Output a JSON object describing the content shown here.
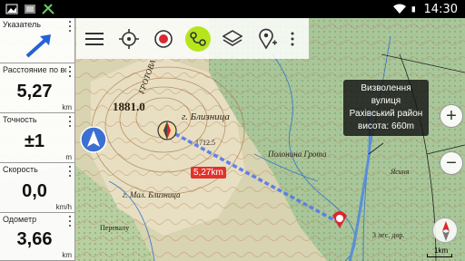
{
  "status_bar": {
    "time": "14:30",
    "left_icons": [
      "photo-icon",
      "image-icon",
      "tools-icon"
    ],
    "right_icons": [
      "wifi-icon",
      "battery-icon"
    ]
  },
  "widgets": [
    {
      "title": "Указатель",
      "value": "",
      "unit": ""
    },
    {
      "title": "Расстояние по вс",
      "value": "5,27",
      "unit": "km"
    },
    {
      "title": "Точность",
      "value": "±1",
      "unit": "m"
    },
    {
      "title": "Скорость",
      "value": "0,0",
      "unit": "km/h"
    },
    {
      "title": "Одометр",
      "value": "3,66",
      "unit": "km"
    }
  ],
  "toolbar": {
    "items": [
      "menu-icon",
      "crosshair-icon",
      "record-icon",
      "route-icon",
      "layers-icon",
      "add-waypoint-icon",
      "more-icon"
    ],
    "accent": "#b5e61d"
  },
  "map": {
    "callout": {
      "line1": "Визволення",
      "line2": "вулиця",
      "line3": "Рахівський район",
      "line4": "висота: 660m"
    },
    "distance_label": "5,27km",
    "scale_label": "1km",
    "zoom_in": "+",
    "zoom_out": "−",
    "labels": {
      "peak": "1881.0",
      "peak_name": "г. Близница",
      "ridge": "ГРОТОВА",
      "grota": "Полонина Грота",
      "mal_bliz": "г. Мал. Близница",
      "perevalu": "Перевалу",
      "height": "1712.5",
      "road": "3 лес. дор.",
      "village": "Ясиня"
    },
    "route_color": "#5577ee",
    "marker_color": "#d9282f"
  }
}
